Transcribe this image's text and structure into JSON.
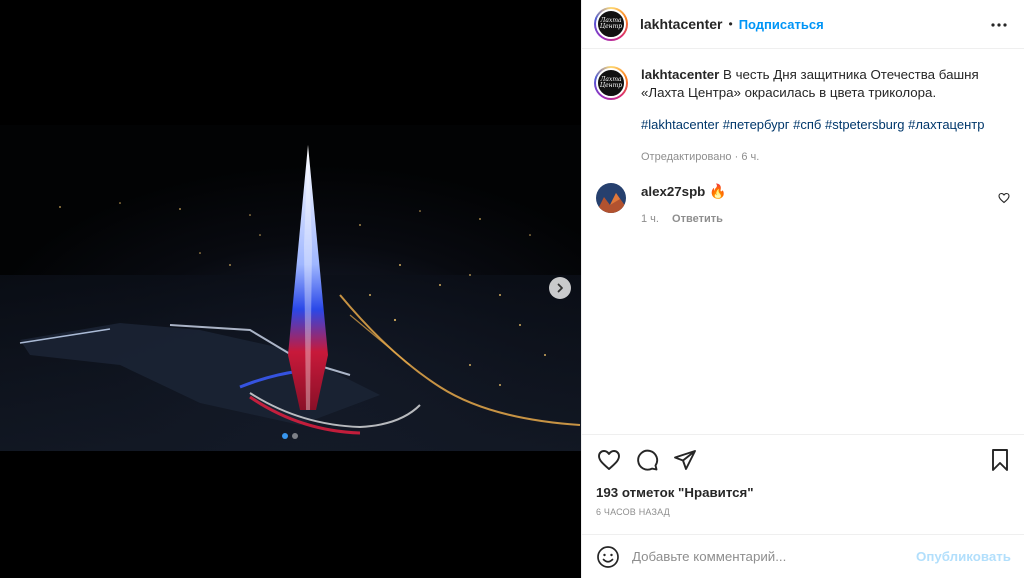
{
  "post": {
    "username": "lakhtacenter",
    "follow_label": "Подписаться",
    "separator": "•",
    "logo_text": "Лахта Центр",
    "caption": {
      "username": "lakhtacenter",
      "text": "В честь Дня защитника Отечества башня «Лахта Центра» окрасилась в цвета триколора.",
      "hashtags": [
        "#lakhtacenter",
        "#петербург",
        "#спб",
        "#stpetersburg",
        "#лахтацентр"
      ],
      "edited_label": "Отредактировано",
      "meta_separator": "·",
      "time": "6 ч."
    },
    "comment": {
      "username": "alex27spb",
      "emoji": "🔥",
      "time": "1 ч.",
      "reply_label": "Ответить"
    },
    "likes_text": "193 отметок \"Нравится\"",
    "timestamp": "6 ЧАСОВ НАЗАД",
    "add_comment_placeholder": "Добавьте комментарий...",
    "publish_label": "Опубликовать",
    "carousel": {
      "total": 2,
      "active_index": 0
    }
  },
  "icons": {
    "more": "more-horizontal-icon",
    "next": "chevron-right-icon",
    "like": "heart-icon",
    "comment": "comment-bubble-icon",
    "share": "paper-plane-icon",
    "save": "bookmark-icon",
    "emoji": "smiley-icon"
  },
  "colors": {
    "accent": "#0095f6",
    "hashtag": "#00376b",
    "muted": "#8e8e8e",
    "publish_disabled": "#b2dffc",
    "active_dot": "#3897f0"
  }
}
